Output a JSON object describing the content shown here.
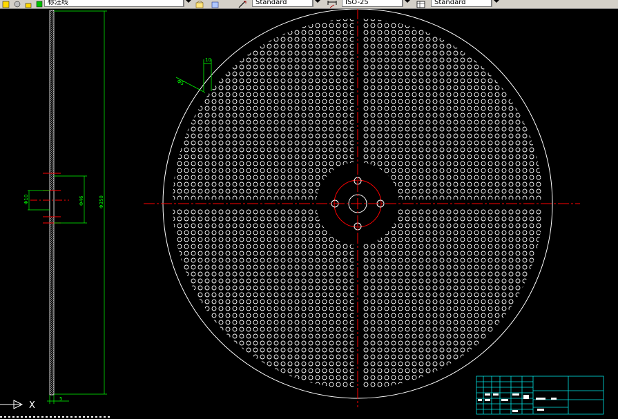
{
  "toolbar": {
    "layer_name": "标注线",
    "text_style": "Standard",
    "dim_style": "ISO-25",
    "table_style": "Standard"
  },
  "drawing": {
    "side_view_labels": {
      "hub_dia": "Φ10",
      "bore_dia": "Φ46",
      "outer_dia": "Φ350",
      "thickness": "5"
    },
    "detail_labels": {
      "hole_pitch": "10",
      "hole_dia": "Φ5"
    },
    "ucs_label": "X",
    "colors": {
      "background": "#000000",
      "geometry": "#ffffff",
      "dimension": "#00ff00",
      "centerline": "#ff0000"
    }
  }
}
